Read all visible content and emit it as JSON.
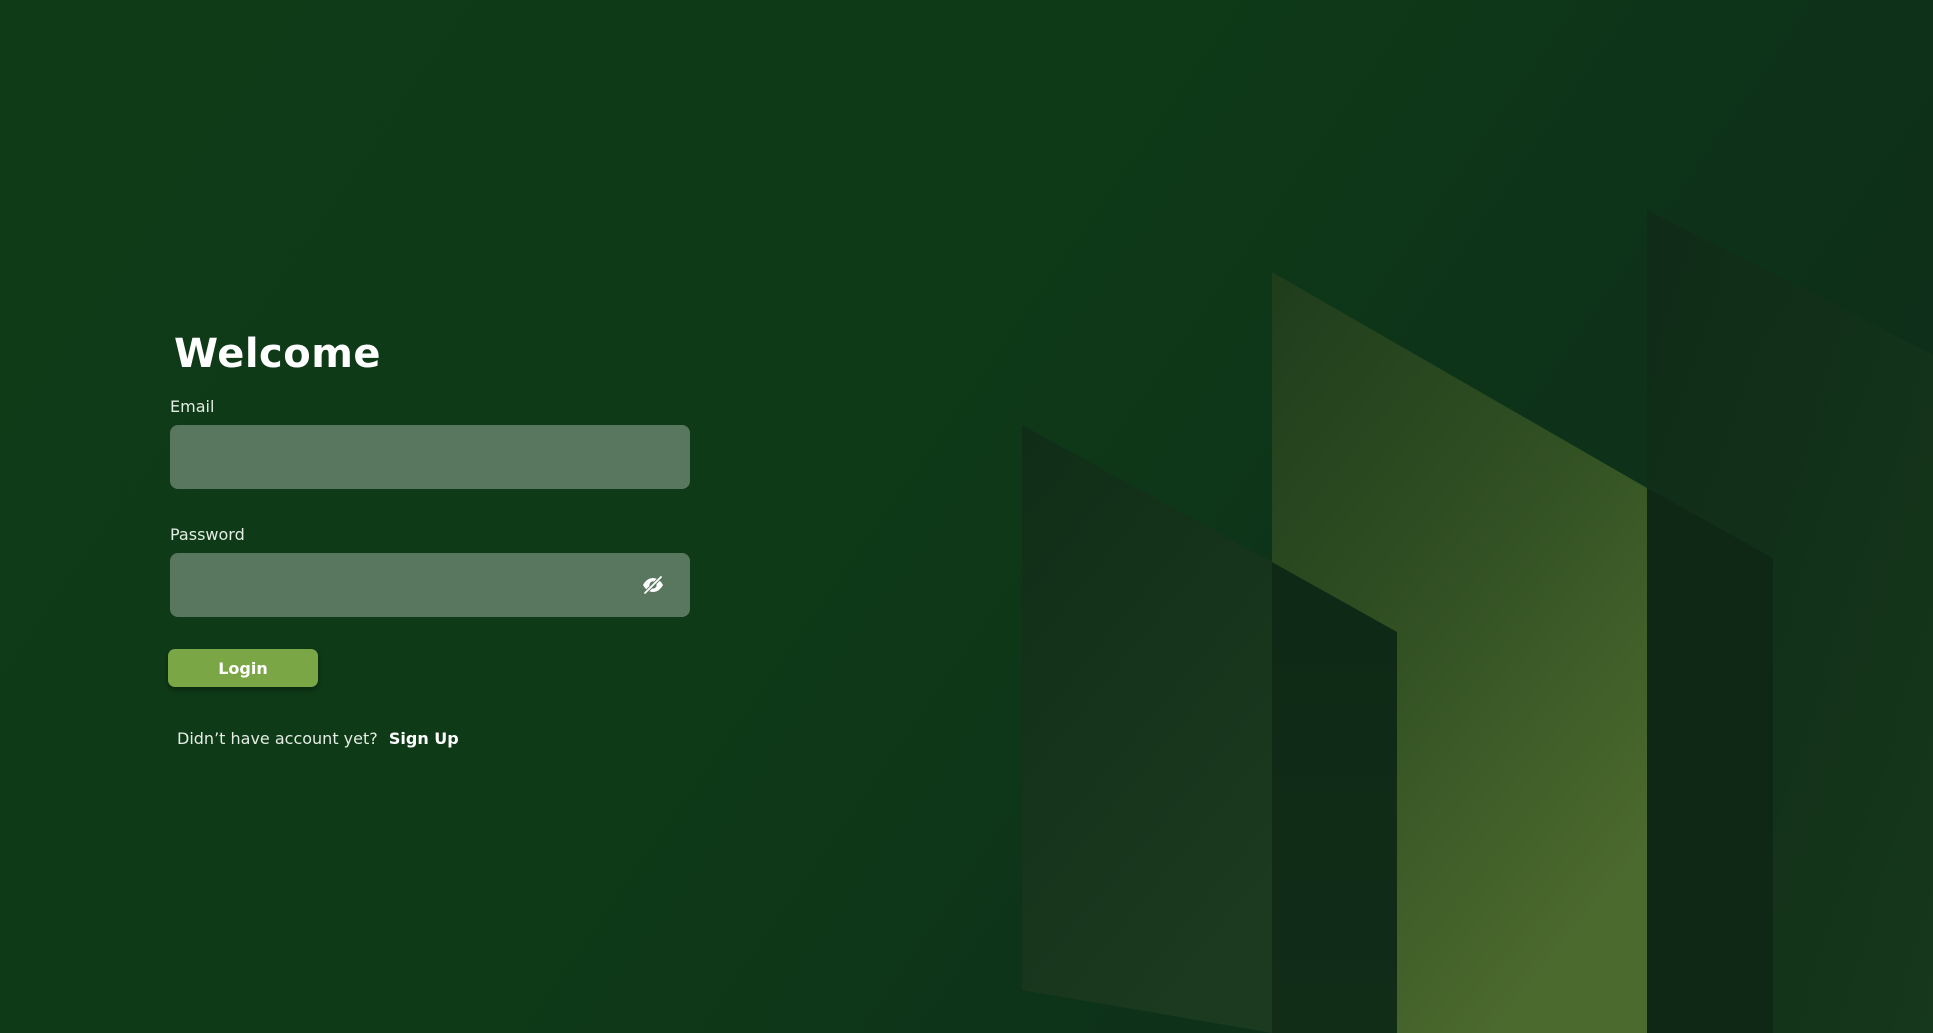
{
  "login": {
    "title": "Welcome",
    "email_label": "Email",
    "email_value": "",
    "password_label": "Password",
    "password_value": "",
    "login_label": "Login",
    "signup_prompt": "Didn’t have account yet?",
    "signup_label": "Sign Up",
    "password_toggle_icon": "eye-off-icon"
  },
  "colors": {
    "background": "#0f3b17",
    "input_fill": "#59775e",
    "button": "#7ba646",
    "text": "#ffffff"
  }
}
